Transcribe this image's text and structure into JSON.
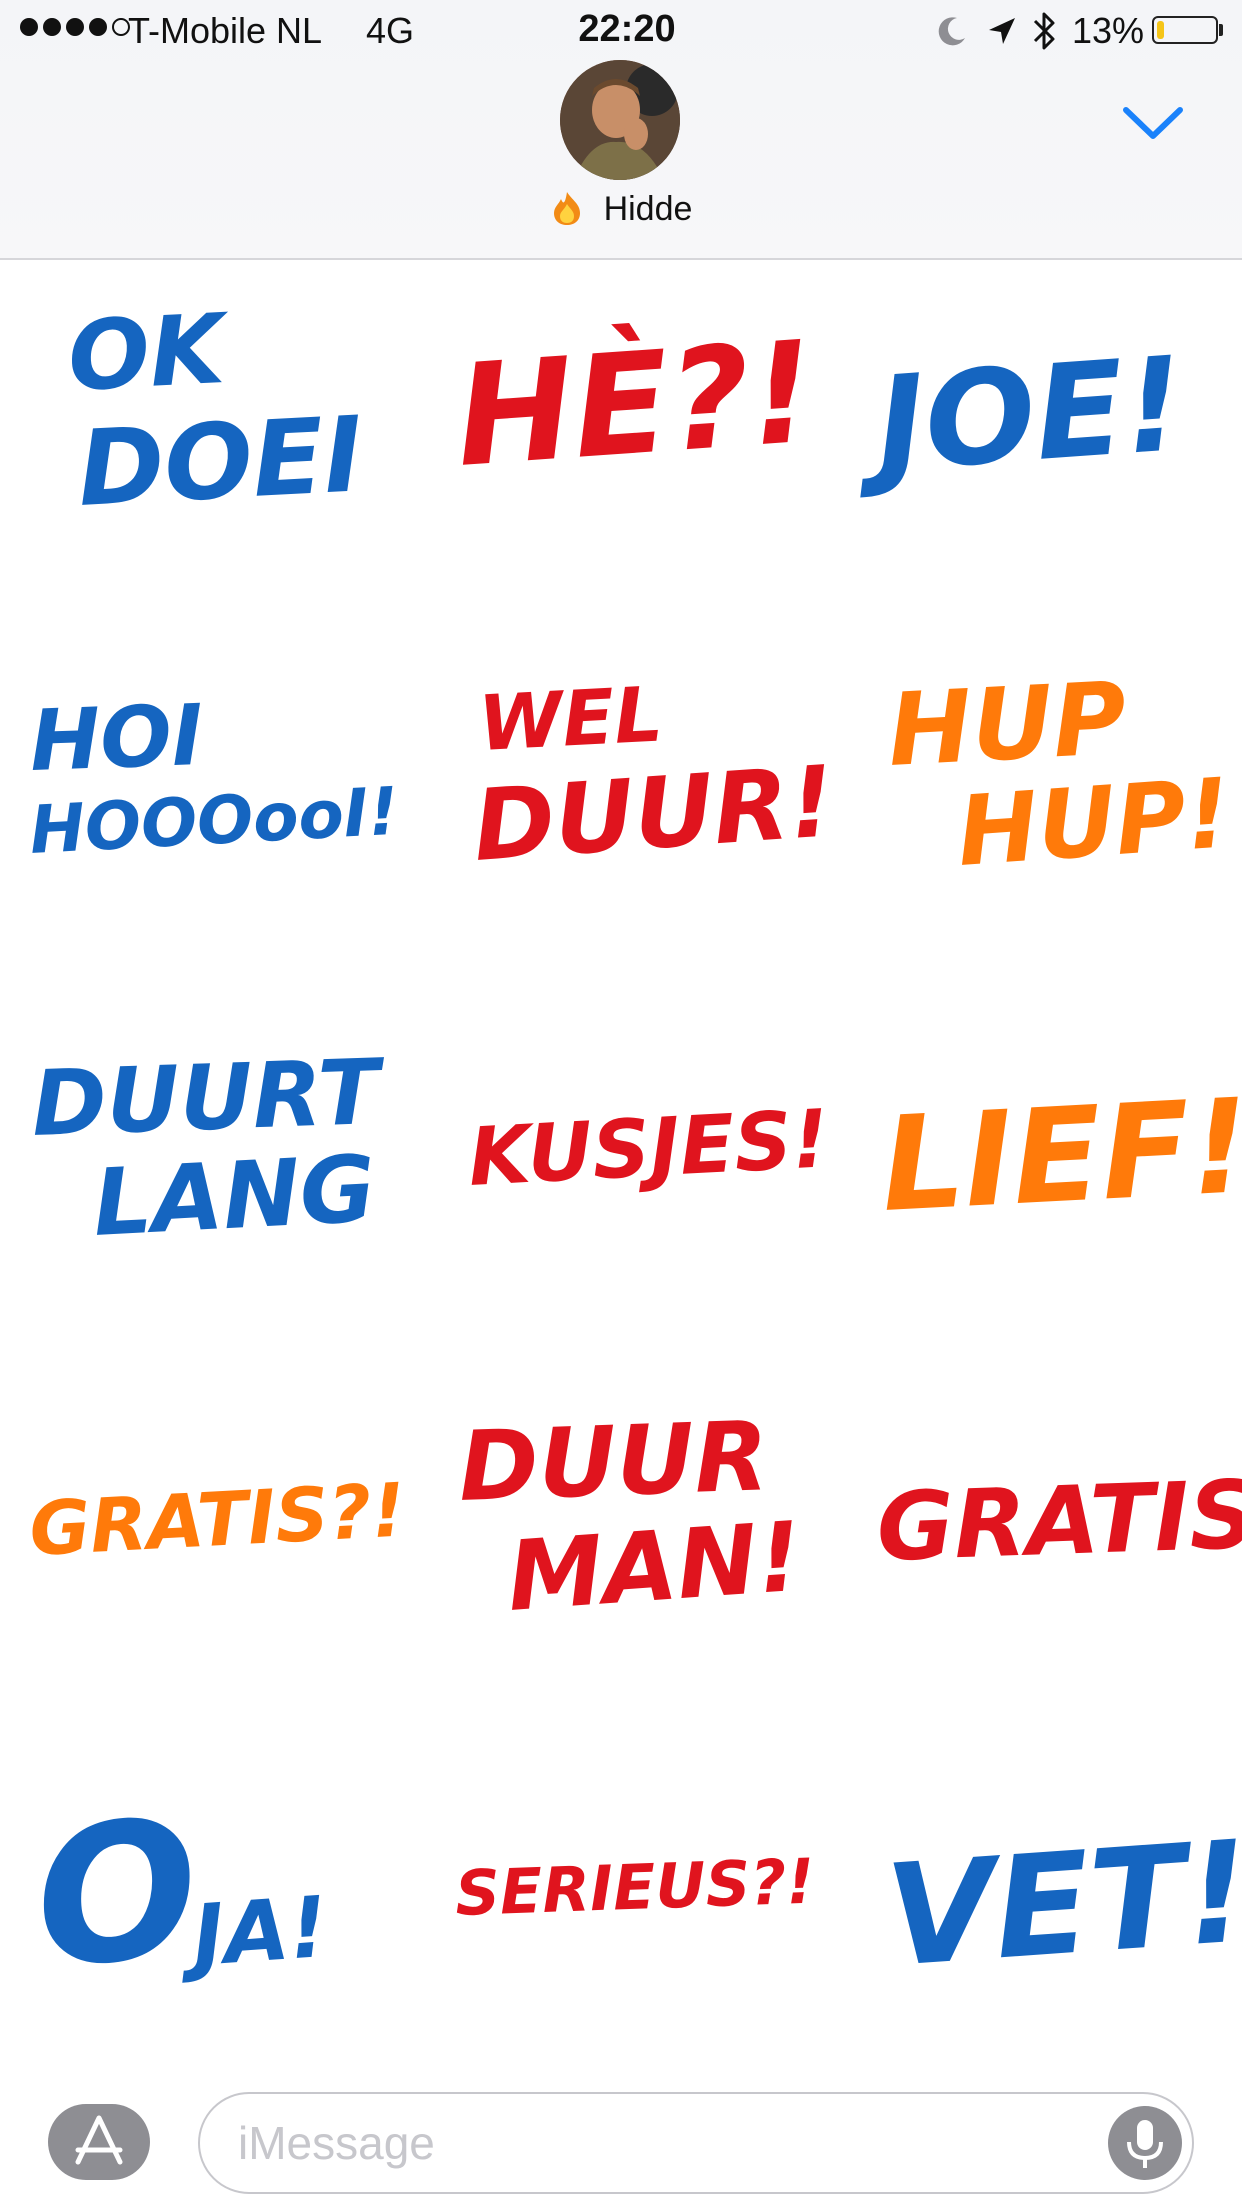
{
  "status_bar": {
    "carrier": "T-Mobile NL",
    "network": "4G",
    "time": "22:20",
    "battery_percent": "13%",
    "battery_level": 0.13,
    "signal_bars_filled": 4,
    "signal_bars_total": 5
  },
  "contact": {
    "name": "Hidde",
    "emoji": "fire-icon"
  },
  "colors": {
    "blue": "#1565c0",
    "red": "#e0141e",
    "orange": "#ff7a0a",
    "accent": "#1a82fb"
  },
  "stickers": [
    {
      "lines": [
        "OK",
        "DOEI"
      ],
      "color": "blue"
    },
    {
      "lines": [
        "HÈ?!"
      ],
      "color": "red"
    },
    {
      "lines": [
        "JOE!"
      ],
      "color": "blue"
    },
    {
      "lines": [
        "HOI",
        "HOOOooI!"
      ],
      "color": "blue"
    },
    {
      "lines": [
        "WEL",
        "DUUR!"
      ],
      "color": "red"
    },
    {
      "lines": [
        "HUP",
        "HUP!"
      ],
      "color": "orange"
    },
    {
      "lines": [
        "DUURT",
        "LANG"
      ],
      "color": "blue"
    },
    {
      "lines": [
        "KUSJES!"
      ],
      "color": "red"
    },
    {
      "lines": [
        "LIEF!"
      ],
      "color": "orange"
    },
    {
      "lines": [
        "GRATIS?!"
      ],
      "color": "orange"
    },
    {
      "lines": [
        "DUUR",
        "MAN!"
      ],
      "color": "red"
    },
    {
      "lines": [
        "GRATIS"
      ],
      "color": "red"
    },
    {
      "lines": [
        "O",
        "JA!"
      ],
      "color": "blue"
    },
    {
      "lines": [
        "SERIEUS?!"
      ],
      "color": "red"
    },
    {
      "lines": [
        "VET!"
      ],
      "color": "blue"
    }
  ],
  "composer": {
    "placeholder": "iMessage",
    "app_store_icon": "app-store-icon",
    "mic_icon": "microphone-icon"
  }
}
